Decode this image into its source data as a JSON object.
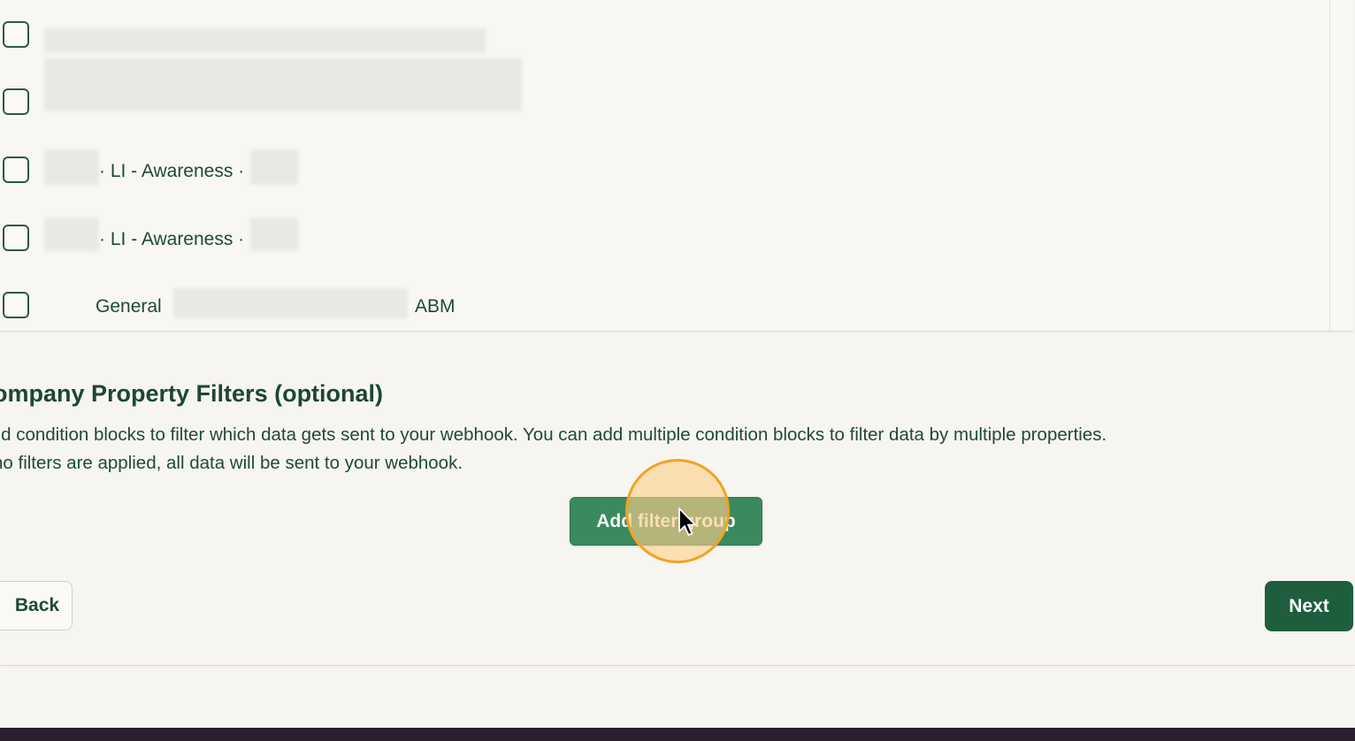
{
  "list": {
    "items": [
      {
        "label": "",
        "checked": false
      },
      {
        "label": "",
        "checked": false
      },
      {
        "label": "· LI - Awareness ·",
        "checked": false
      },
      {
        "label": "· LI - Awareness ·",
        "checked": false
      },
      {
        "label_start": "General",
        "label_end": "ABM",
        "checked": false
      }
    ]
  },
  "section": {
    "title": "ompany Property Filters (optional)",
    "description_line1": "ild condition blocks to filter which data gets sent to your webhook. You can add multiple condition blocks to filter data by multiple properties.",
    "description_line2": "no filters are applied, all data will be sent to your webhook."
  },
  "buttons": {
    "add_filter_group": "Add filter group",
    "back": "Back",
    "next": "Next"
  },
  "colors": {
    "primary": "#1e5e3d",
    "accent": "#3b8a5e",
    "highlight": "#f0a321",
    "background": "#f7f5f0"
  }
}
